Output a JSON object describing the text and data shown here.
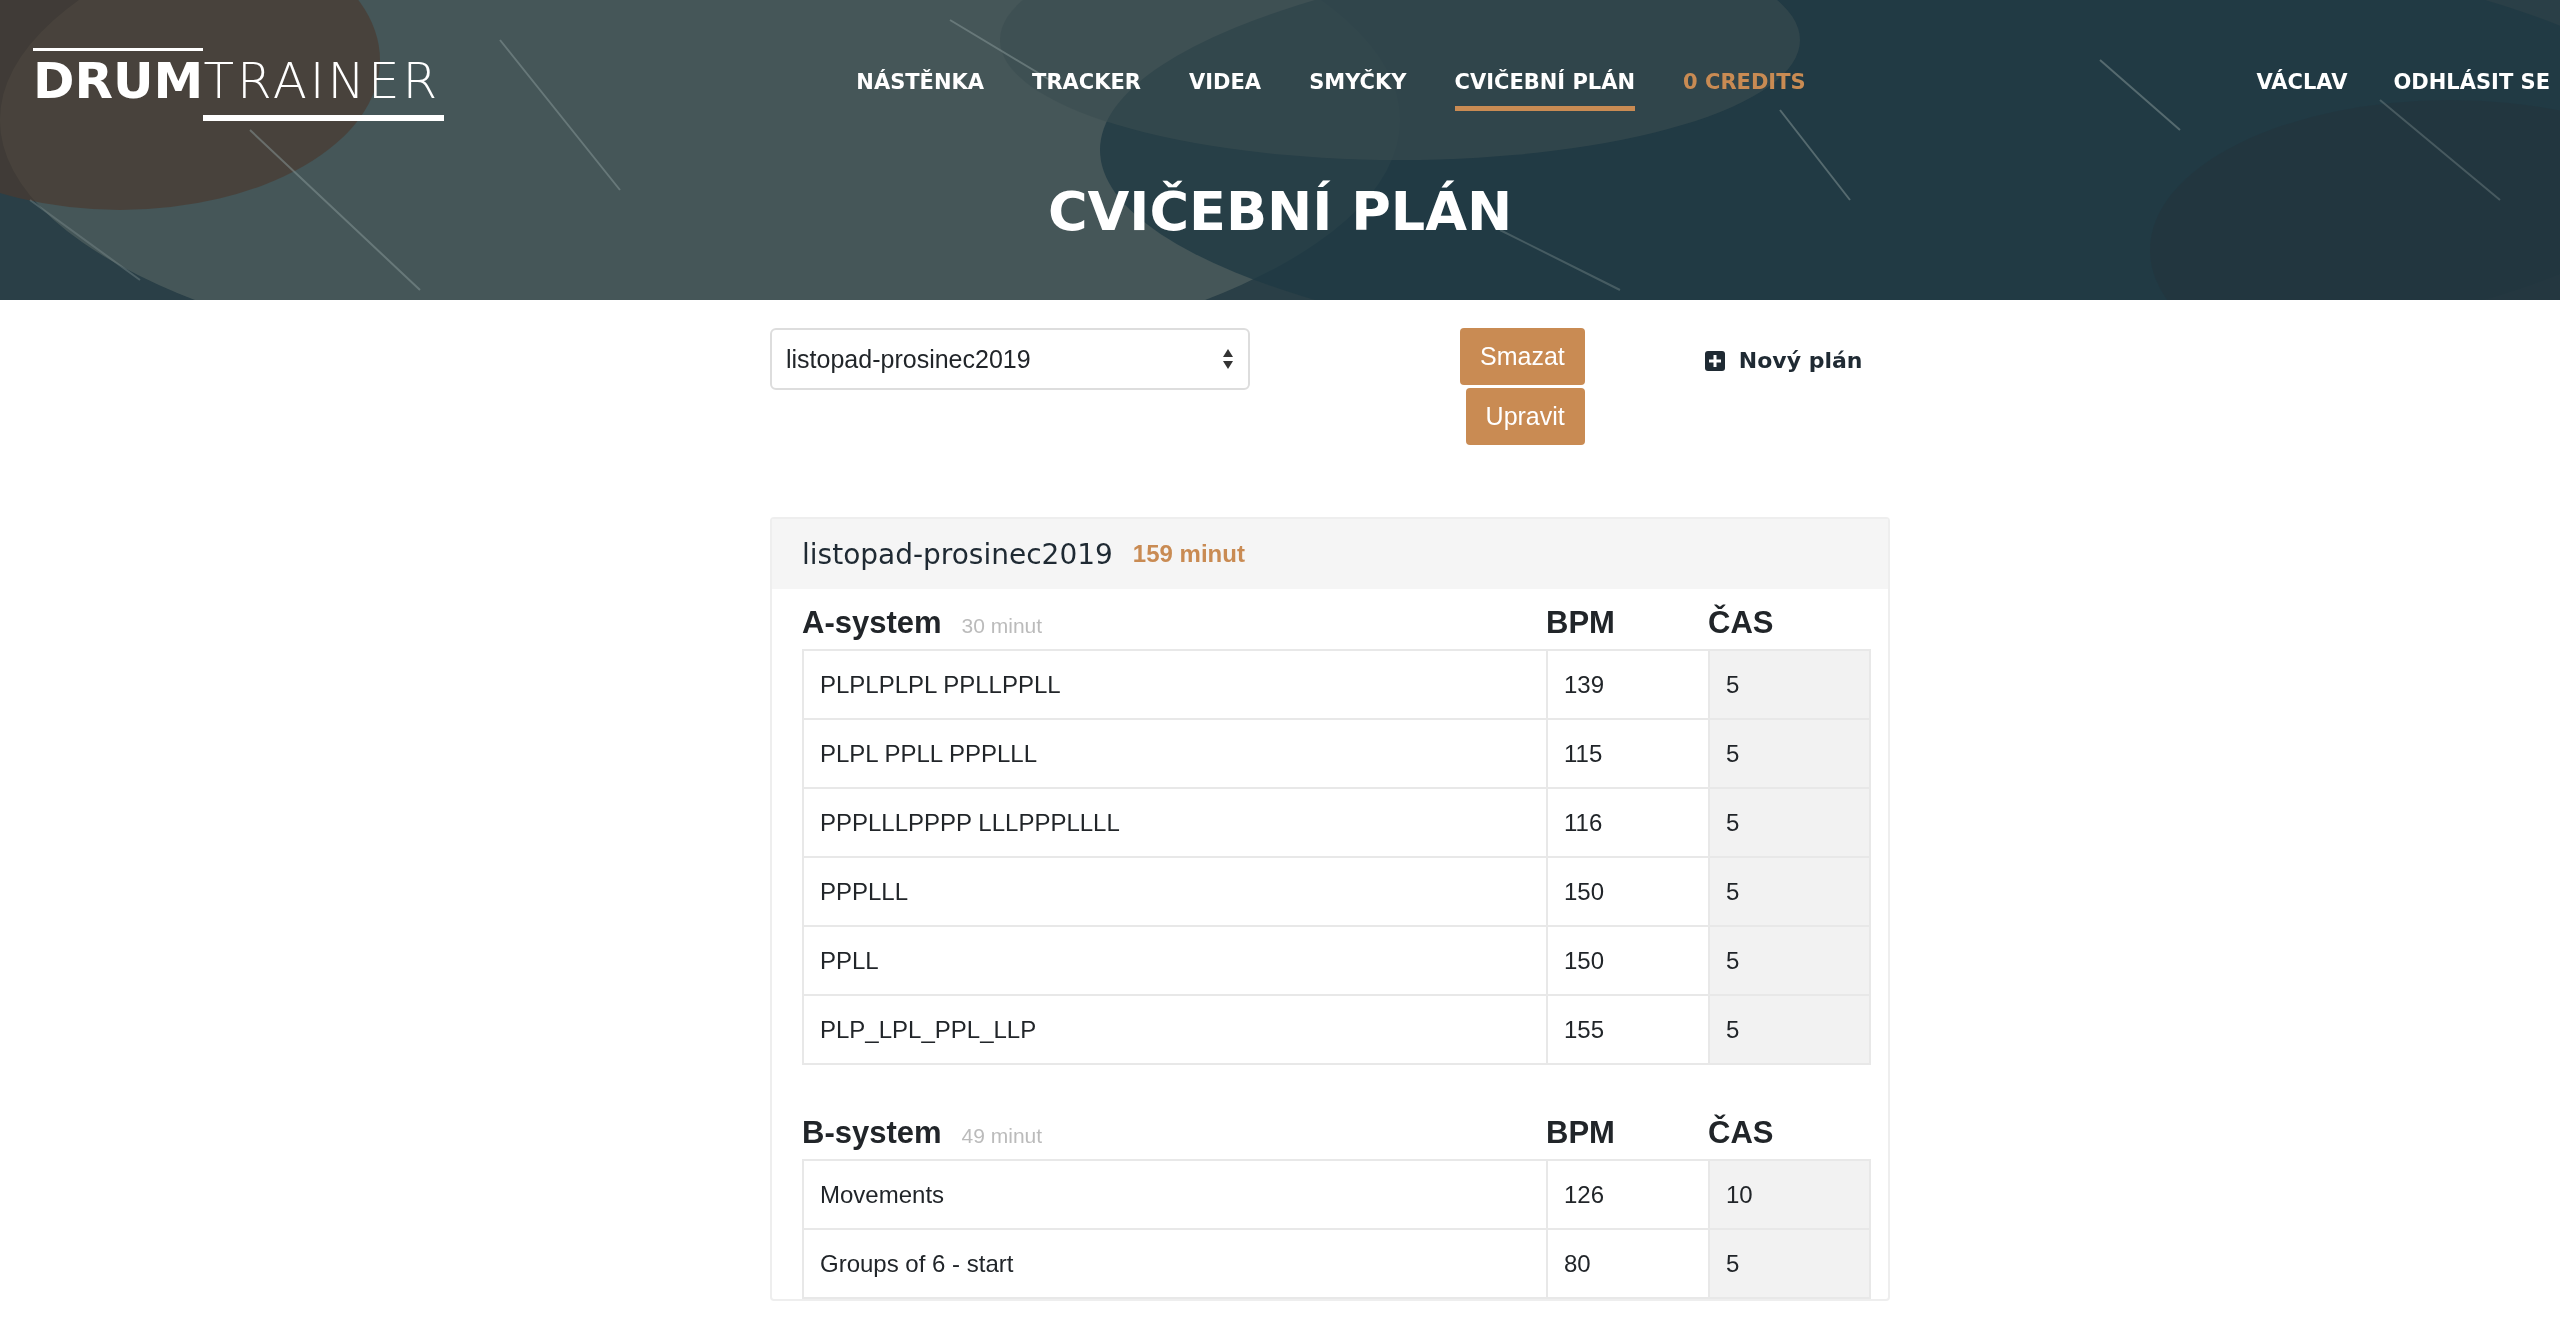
{
  "logo": {
    "strong": "DRUM",
    "light": "TRAINER"
  },
  "nav": [
    {
      "label": "NÁSTĚNKA",
      "selected": false,
      "kind": "link"
    },
    {
      "label": "TRACKER",
      "selected": false,
      "kind": "link"
    },
    {
      "label": "VIDEA",
      "selected": false,
      "kind": "link"
    },
    {
      "label": "SMYČKY",
      "selected": false,
      "kind": "link"
    },
    {
      "label": "CVIČEBNÍ PLÁN",
      "selected": true,
      "kind": "link"
    },
    {
      "label": "0 CREDITS",
      "selected": false,
      "kind": "credits"
    }
  ],
  "user_nav": [
    "VÁCLAV",
    "ODHLÁSIT SE"
  ],
  "page_title": "CVIČEBNÍ PLÁN",
  "plan_select": {
    "value": "listopad-prosinec2019"
  },
  "buttons": [
    "Smazat",
    "Upravit"
  ],
  "new_plan": "Nový plán",
  "plan": {
    "name": "listopad-prosinec2019",
    "total": "159 minut",
    "sections": [
      {
        "title": "A-system",
        "duration": "30 minut",
        "bpm_header": "BPM",
        "time_header": "ČAS",
        "rows": [
          [
            "PLPLPLPL PPLLPPLL",
            "139",
            "5"
          ],
          [
            "PLPL PPLL PPPLLL",
            "115",
            "5"
          ],
          [
            "PPPLLLPPPP LLLPPPLLLL",
            "116",
            "5"
          ],
          [
            "PPPLLL",
            "150",
            "5"
          ],
          [
            "PPLL",
            "150",
            "5"
          ],
          [
            "PLP_LPL_PPL_LLP",
            "155",
            "5"
          ]
        ]
      },
      {
        "title": "B-system",
        "duration": "49 minut",
        "bpm_header": "BPM",
        "time_header": "ČAS",
        "rows": [
          [
            "Movements",
            "126",
            "10"
          ],
          [
            "Groups of 6 - start",
            "80",
            "5"
          ]
        ]
      }
    ]
  }
}
